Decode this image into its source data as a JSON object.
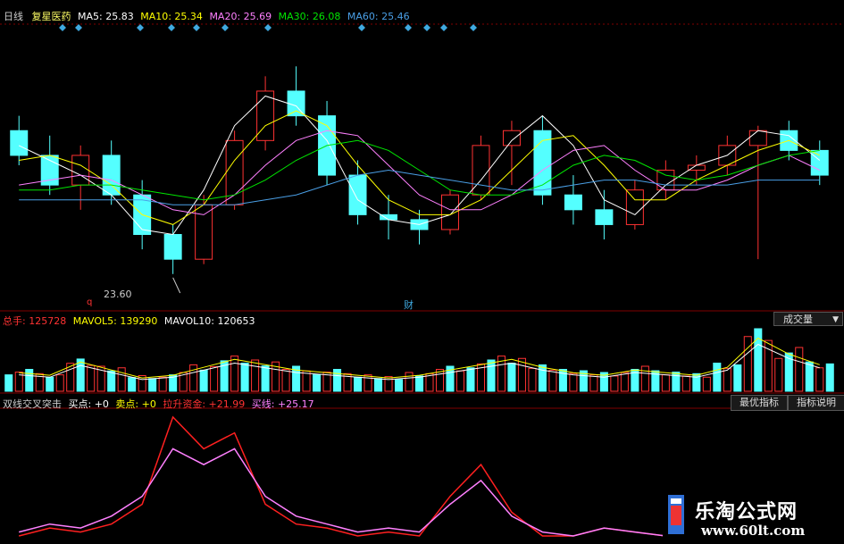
{
  "colors": {
    "up": "#ff3232",
    "down": "#54ffff",
    "ma5": "#ffffff",
    "ma10": "#ffff00",
    "ma20": "#ff80ff",
    "ma30": "#00e600",
    "ma60": "#4a9fe6",
    "grid": "#800000",
    "marker": "#3fa9e0"
  },
  "header": {
    "period": "日线",
    "stock_name": "复星医药",
    "ma5": "MA5: 25.83",
    "ma10": "MA10: 25.34",
    "ma20": "MA20: 25.69",
    "ma30": "MA30: 26.08",
    "ma60": "MA60: 25.46"
  },
  "price_panel": {
    "low_label": "23.60",
    "q_marker": "q",
    "cai_marker": "财"
  },
  "volume_panel": {
    "total_label": "总手: 125728",
    "mavol5": "MAVOL5: 139290",
    "mavol10": "MAVOL10: 120653",
    "selector": "成交量",
    "selector_icon": "dropdown-triangle"
  },
  "indicator_panel": {
    "title": "双线交叉突击",
    "buy_point": "买点: +0",
    "sell_point": "卖点: +0",
    "pull_fund": "拉升资金: +21.99",
    "buy_line": "买线: +25.17",
    "best_button": "最优指标",
    "explain_button": "指标说明"
  },
  "watermark": {
    "title": "乐淘公式网",
    "url": "www.60lt.com"
  },
  "chart_data": {
    "type": "line",
    "series": [
      {
        "name": "MA5",
        "values": [
          26.2,
          25.9,
          25.6,
          25.2,
          24.5,
          24.4,
          25.3,
          26.6,
          27.2,
          27.0,
          26.3,
          25.1,
          24.7,
          24.6,
          24.8,
          25.5,
          26.3,
          26.8,
          26.2,
          25.1,
          24.8,
          25.4,
          25.8,
          26.0,
          26.5,
          26.4,
          25.9
        ]
      },
      {
        "name": "MA10",
        "values": [
          25.9,
          26.0,
          25.8,
          25.4,
          24.8,
          24.6,
          25.0,
          25.9,
          26.6,
          26.9,
          26.6,
          25.8,
          25.1,
          24.8,
          24.8,
          25.1,
          25.7,
          26.3,
          26.4,
          25.8,
          25.1,
          25.1,
          25.5,
          25.8,
          26.1,
          26.3,
          26.0
        ]
      },
      {
        "name": "MA20",
        "values": [
          25.4,
          25.5,
          25.6,
          25.5,
          25.2,
          24.9,
          24.8,
          25.2,
          25.8,
          26.3,
          26.5,
          26.4,
          25.8,
          25.2,
          24.9,
          24.9,
          25.2,
          25.7,
          26.1,
          26.2,
          25.7,
          25.3,
          25.3,
          25.5,
          25.8,
          26.0,
          25.7
        ]
      },
      {
        "name": "MA30",
        "values": [
          25.3,
          25.3,
          25.4,
          25.4,
          25.3,
          25.2,
          25.1,
          25.2,
          25.5,
          25.9,
          26.2,
          26.3,
          26.1,
          25.7,
          25.3,
          25.2,
          25.2,
          25.4,
          25.8,
          26.0,
          25.9,
          25.6,
          25.5,
          25.6,
          25.8,
          26.0,
          26.1
        ]
      },
      {
        "name": "MA60",
        "values": [
          25.1,
          25.1,
          25.1,
          25.1,
          25.1,
          25.0,
          25.0,
          25.0,
          25.1,
          25.2,
          25.4,
          25.6,
          25.7,
          25.6,
          25.5,
          25.4,
          25.3,
          25.3,
          25.4,
          25.5,
          25.5,
          25.4,
          25.4,
          25.4,
          25.5,
          25.5,
          25.5
        ]
      }
    ],
    "price_range": [
      23.0,
      28.6
    ],
    "candles": [
      [
        26.5,
        26.8,
        25.8,
        26.0
      ],
      [
        26.0,
        26.4,
        25.2,
        25.4
      ],
      [
        25.4,
        26.2,
        24.9,
        26.0
      ],
      [
        26.0,
        26.3,
        25.0,
        25.2
      ],
      [
        25.2,
        25.5,
        24.1,
        24.4
      ],
      [
        24.4,
        24.6,
        23.6,
        23.9
      ],
      [
        23.9,
        25.2,
        23.8,
        25.0
      ],
      [
        25.0,
        26.5,
        24.9,
        26.3
      ],
      [
        26.3,
        27.6,
        26.1,
        27.3
      ],
      [
        27.3,
        27.8,
        26.6,
        26.8
      ],
      [
        26.8,
        27.1,
        25.4,
        25.6
      ],
      [
        25.6,
        25.9,
        24.6,
        24.8
      ],
      [
        24.8,
        25.2,
        24.3,
        24.7
      ],
      [
        24.7,
        24.9,
        24.2,
        24.5
      ],
      [
        24.5,
        25.3,
        24.4,
        25.2
      ],
      [
        25.2,
        26.4,
        25.1,
        26.2
      ],
      [
        26.2,
        26.7,
        25.4,
        26.5
      ],
      [
        26.5,
        26.8,
        25.0,
        25.2
      ],
      [
        25.2,
        25.6,
        24.6,
        24.9
      ],
      [
        24.9,
        25.3,
        24.3,
        24.6
      ],
      [
        24.6,
        25.5,
        24.5,
        25.3
      ],
      [
        25.3,
        25.9,
        25.1,
        25.7
      ],
      [
        25.7,
        26.0,
        25.4,
        25.8
      ],
      [
        25.8,
        26.4,
        25.6,
        26.2
      ],
      [
        26.2,
        26.6,
        23.9,
        26.5
      ],
      [
        26.5,
        26.7,
        25.9,
        26.1
      ],
      [
        26.1,
        26.3,
        25.4,
        25.6
      ]
    ],
    "volumes": [
      0.35,
      0.3,
      0.55,
      0.4,
      0.25,
      0.3,
      0.45,
      0.6,
      0.5,
      0.4,
      0.35,
      0.3,
      0.25,
      0.3,
      0.4,
      0.5,
      0.6,
      0.45,
      0.35,
      0.3,
      0.4,
      0.35,
      0.3,
      0.45,
      1.0,
      0.7,
      0.5
    ],
    "indicator_lines": [
      {
        "name": "拉升资金",
        "values": [
          0,
          2,
          1,
          3,
          8,
          30,
          22,
          26,
          8,
          3,
          2,
          0,
          1,
          0,
          10,
          18,
          6,
          0,
          0,
          2,
          1,
          0,
          0,
          0,
          0,
          0,
          0
        ]
      },
      {
        "name": "买线",
        "values": [
          1,
          3,
          2,
          5,
          10,
          22,
          18,
          22,
          10,
          5,
          3,
          1,
          2,
          1,
          8,
          14,
          5,
          1,
          0,
          2,
          1,
          0,
          0,
          0,
          0,
          0,
          0
        ]
      }
    ]
  }
}
